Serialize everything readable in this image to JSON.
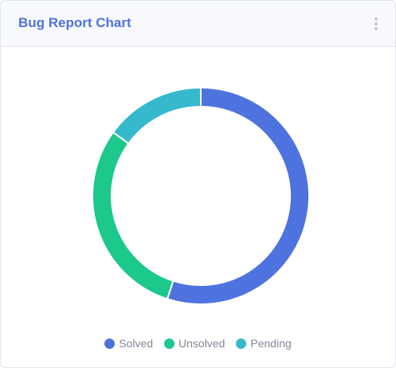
{
  "card": {
    "title": "Bug Report Chart",
    "title_color": "#4e73df",
    "menu_icon": "vertical-ellipsis-icon"
  },
  "chart_data": {
    "type": "pie",
    "variant": "doughnut",
    "title": "Bug Report Chart",
    "categories": [
      "Solved",
      "Unsolved",
      "Pending"
    ],
    "values": [
      55,
      30,
      15
    ],
    "colors": [
      "#4e73df",
      "#1cc88a",
      "#36b9cc"
    ],
    "legend_position": "bottom",
    "start_angle": "top, clockwise"
  }
}
